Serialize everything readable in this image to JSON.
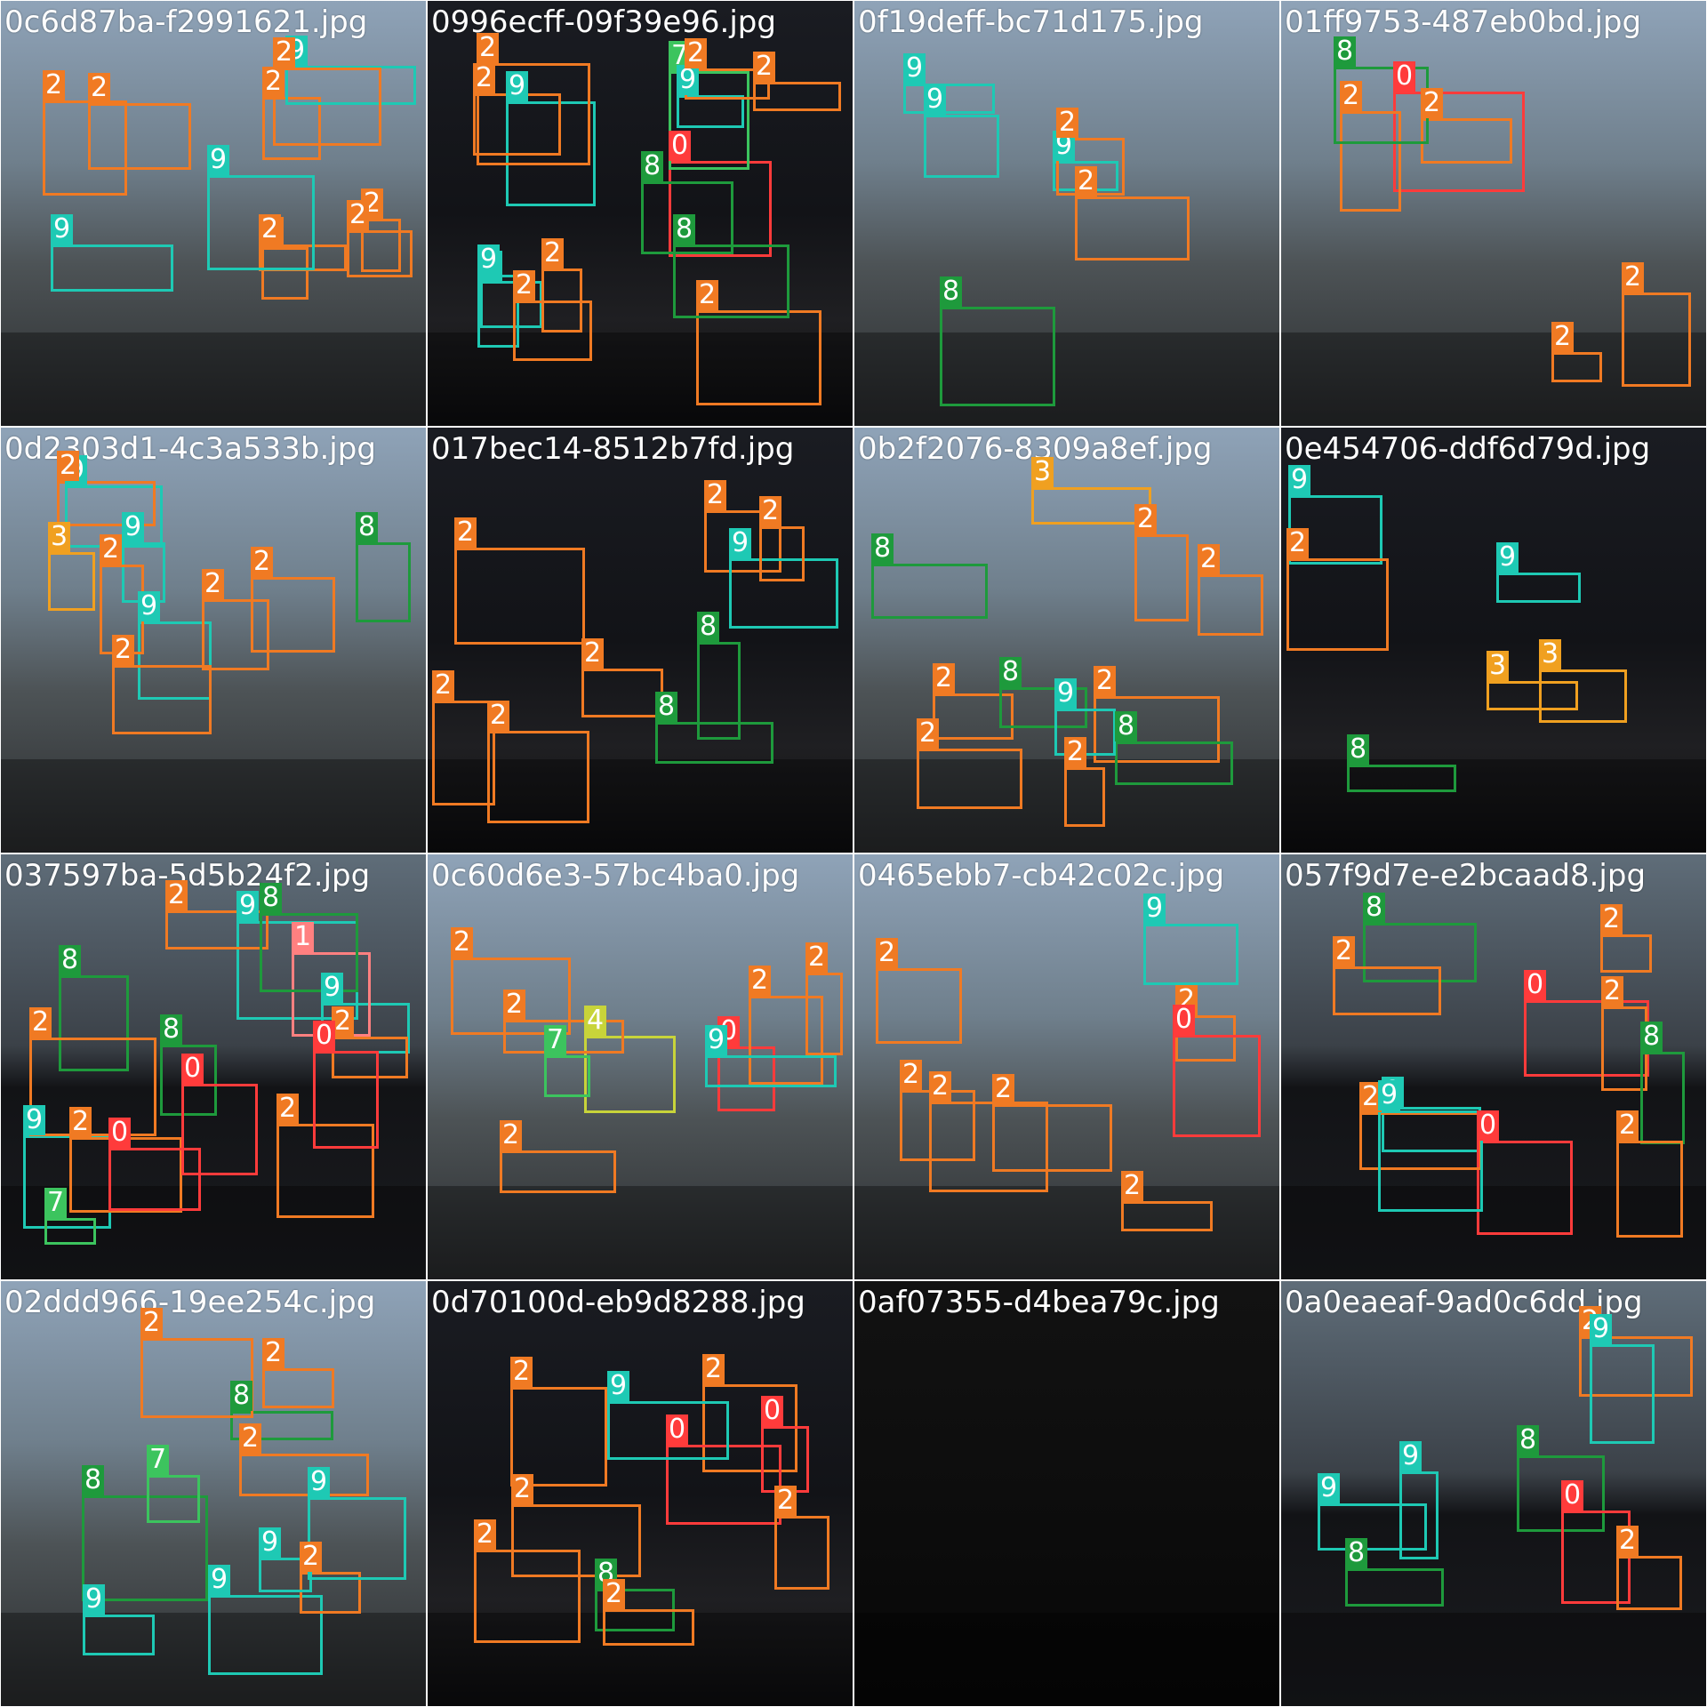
{
  "class_colors": {
    "0": "#ff3b3b",
    "1": "#ff8080",
    "2": "#f07a23",
    "3": "#f0a020",
    "4": "#c8d43a",
    "7": "#3cc45e",
    "8": "#1e9a3c",
    "9": "#1ec9b4"
  },
  "tiles": [
    {
      "filename": "0c6d87ba-f2991621.jpg",
      "scene": "day",
      "labels": [
        {
          "cls": "2"
        },
        {
          "cls": "2"
        },
        {
          "cls": "2"
        },
        {
          "cls": "2"
        },
        {
          "cls": "2"
        },
        {
          "cls": "2"
        },
        {
          "cls": "2"
        },
        {
          "cls": "9"
        },
        {
          "cls": "9"
        },
        {
          "cls": "9"
        },
        {
          "cls": "2"
        }
      ]
    },
    {
      "filename": "0996ecff-09f39e96.jpg",
      "scene": "night",
      "labels": [
        {
          "cls": "9"
        },
        {
          "cls": "0"
        },
        {
          "cls": "7"
        },
        {
          "cls": "9"
        },
        {
          "cls": "9"
        },
        {
          "cls": "2"
        },
        {
          "cls": "2"
        },
        {
          "cls": "2"
        },
        {
          "cls": "9"
        },
        {
          "cls": "8"
        },
        {
          "cls": "2"
        },
        {
          "cls": "2"
        },
        {
          "cls": "2"
        },
        {
          "cls": "2"
        },
        {
          "cls": "8"
        }
      ]
    },
    {
      "filename": "0f19deff-bc71d175.jpg",
      "scene": "day",
      "labels": [
        {
          "cls": "9"
        },
        {
          "cls": "2"
        },
        {
          "cls": "2"
        },
        {
          "cls": "8"
        },
        {
          "cls": "9"
        },
        {
          "cls": "9"
        }
      ]
    },
    {
      "filename": "01ff9753-487eb0bd.jpg",
      "scene": "day",
      "labels": [
        {
          "cls": "2"
        },
        {
          "cls": "0"
        },
        {
          "cls": "2"
        },
        {
          "cls": "2"
        },
        {
          "cls": "2"
        },
        {
          "cls": "8"
        }
      ]
    },
    {
      "filename": "0d2303d1-4c3a533b.jpg",
      "scene": "day",
      "labels": [
        {
          "cls": "9"
        },
        {
          "cls": "9"
        },
        {
          "cls": "2"
        },
        {
          "cls": "2"
        },
        {
          "cls": "3"
        },
        {
          "cls": "2"
        },
        {
          "cls": "9"
        },
        {
          "cls": "8"
        },
        {
          "cls": "2"
        },
        {
          "cls": "2"
        }
      ]
    },
    {
      "filename": "017bec14-8512b7fd.jpg",
      "scene": "night",
      "labels": [
        {
          "cls": "2"
        },
        {
          "cls": "2"
        },
        {
          "cls": "8"
        },
        {
          "cls": "8"
        },
        {
          "cls": "2"
        },
        {
          "cls": "2"
        },
        {
          "cls": "2"
        },
        {
          "cls": "9"
        },
        {
          "cls": "2"
        }
      ]
    },
    {
      "filename": "0b2f2076-8309a8ef.jpg",
      "scene": "day",
      "labels": [
        {
          "cls": "2"
        },
        {
          "cls": "2"
        },
        {
          "cls": "2"
        },
        {
          "cls": "8"
        },
        {
          "cls": "8"
        },
        {
          "cls": "2"
        },
        {
          "cls": "3"
        },
        {
          "cls": "2"
        },
        {
          "cls": "8"
        },
        {
          "cls": "9"
        },
        {
          "cls": "2"
        }
      ]
    },
    {
      "filename": "0e454706-ddf6d79d.jpg",
      "scene": "night",
      "labels": [
        {
          "cls": "9"
        },
        {
          "cls": "3"
        },
        {
          "cls": "3"
        },
        {
          "cls": "9"
        },
        {
          "cls": "2"
        },
        {
          "cls": "8"
        }
      ]
    },
    {
      "filename": "037597ba-5d5b24f2.jpg",
      "scene": "mixed",
      "labels": [
        {
          "cls": "9"
        },
        {
          "cls": "8"
        },
        {
          "cls": "9"
        },
        {
          "cls": "8"
        },
        {
          "cls": "9"
        },
        {
          "cls": "2"
        },
        {
          "cls": "2"
        },
        {
          "cls": "2"
        },
        {
          "cls": "0"
        },
        {
          "cls": "1"
        },
        {
          "cls": "7"
        },
        {
          "cls": "0"
        },
        {
          "cls": "0"
        },
        {
          "cls": "2"
        },
        {
          "cls": "2"
        },
        {
          "cls": "8"
        }
      ]
    },
    {
      "filename": "0c60d6e3-57bc4ba0.jpg",
      "scene": "day",
      "labels": [
        {
          "cls": "4"
        },
        {
          "cls": "2"
        },
        {
          "cls": "0"
        },
        {
          "cls": "7"
        },
        {
          "cls": "2"
        },
        {
          "cls": "2"
        },
        {
          "cls": "2"
        },
        {
          "cls": "9"
        },
        {
          "cls": "2"
        }
      ]
    },
    {
      "filename": "0465ebb7-cb42c02c.jpg",
      "scene": "day",
      "labels": [
        {
          "cls": "9"
        },
        {
          "cls": "2"
        },
        {
          "cls": "2"
        },
        {
          "cls": "2"
        },
        {
          "cls": "2"
        },
        {
          "cls": "2"
        },
        {
          "cls": "2"
        },
        {
          "cls": "0"
        }
      ]
    },
    {
      "filename": "057f9d7e-e2bcaad8.jpg",
      "scene": "mixed",
      "labels": [
        {
          "cls": "9"
        },
        {
          "cls": "2"
        },
        {
          "cls": "0"
        },
        {
          "cls": "0"
        },
        {
          "cls": "2"
        },
        {
          "cls": "2"
        },
        {
          "cls": "8"
        },
        {
          "cls": "8"
        },
        {
          "cls": "2"
        },
        {
          "cls": "9"
        },
        {
          "cls": "2"
        }
      ]
    },
    {
      "filename": "02ddd966-19ee254c.jpg",
      "scene": "day",
      "labels": [
        {
          "cls": "8"
        },
        {
          "cls": "9"
        },
        {
          "cls": "2"
        },
        {
          "cls": "2"
        },
        {
          "cls": "2"
        },
        {
          "cls": "8"
        },
        {
          "cls": "7"
        },
        {
          "cls": "9"
        },
        {
          "cls": "9"
        },
        {
          "cls": "2"
        },
        {
          "cls": "9"
        }
      ]
    },
    {
      "filename": "0d70100d-eb9d8288.jpg",
      "scene": "night",
      "labels": [
        {
          "cls": "2"
        },
        {
          "cls": "8"
        },
        {
          "cls": "2"
        },
        {
          "cls": "0"
        },
        {
          "cls": "0"
        },
        {
          "cls": "2"
        },
        {
          "cls": "2"
        },
        {
          "cls": "2"
        },
        {
          "cls": "2"
        },
        {
          "cls": "9"
        }
      ]
    },
    {
      "filename": "0af07355-d4bea79c.jpg",
      "scene": "dark",
      "labels": []
    },
    {
      "filename": "0a0eaeaf-9ad0c6dd.jpg",
      "scene": "mixed",
      "labels": [
        {
          "cls": "2"
        },
        {
          "cls": "9"
        },
        {
          "cls": "9"
        },
        {
          "cls": "8"
        },
        {
          "cls": "8"
        },
        {
          "cls": "9"
        },
        {
          "cls": "0"
        },
        {
          "cls": "2"
        }
      ]
    }
  ]
}
